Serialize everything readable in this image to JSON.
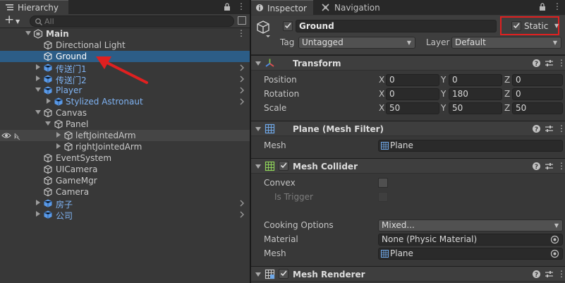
{
  "hierarchy": {
    "tab_label": "Hierarchy",
    "tab_icon": "hierarchy-list-icon",
    "add_button": "+",
    "search_placeholder": "All",
    "rows": [
      {
        "label": "Main",
        "type": "scene"
      },
      {
        "label": "Directional Light",
        "type": "gameobject"
      },
      {
        "label": "Ground",
        "type": "gameobject",
        "selected": true
      },
      {
        "label": "传送门1",
        "type": "prefab"
      },
      {
        "label": "传送门2",
        "type": "prefab"
      },
      {
        "label": "Player",
        "type": "prefab"
      },
      {
        "label": "Stylized Astronaut",
        "type": "prefab"
      },
      {
        "label": "Canvas",
        "type": "gameobject"
      },
      {
        "label": "Panel",
        "type": "gameobject"
      },
      {
        "label": "leftJointedArm",
        "type": "gameobject"
      },
      {
        "label": "rightJointedArm",
        "type": "gameobject"
      },
      {
        "label": "EventSystem",
        "type": "gameobject"
      },
      {
        "label": "UICamera",
        "type": "gameobject"
      },
      {
        "label": "GameMgr",
        "type": "gameobject"
      },
      {
        "label": "Camera",
        "type": "gameobject"
      },
      {
        "label": "房子",
        "type": "prefab"
      },
      {
        "label": "公司",
        "type": "prefab"
      }
    ]
  },
  "annotation": {
    "arrow_color": "#e02020",
    "highlight_color": "#e02020"
  },
  "inspector": {
    "tabs": [
      {
        "label": "Inspector",
        "icon": "info-icon",
        "active": true
      },
      {
        "label": "Navigation",
        "icon": "compass-icon",
        "active": false
      }
    ],
    "object": {
      "active": true,
      "name": "Ground",
      "static_checked": true,
      "static_label": "Static",
      "tag_label": "Tag",
      "tag_value": "Untagged",
      "layer_label": "Layer",
      "layer_value": "Default"
    },
    "transform": {
      "title": "Transform",
      "position_label": "Position",
      "rotation_label": "Rotation",
      "scale_label": "Scale",
      "axis_x": "X",
      "axis_y": "Y",
      "axis_z": "Z",
      "position": {
        "x": "0",
        "y": "0",
        "z": "0"
      },
      "rotation": {
        "x": "0",
        "y": "180",
        "z": "0"
      },
      "scale": {
        "x": "50",
        "y": "50",
        "z": "50"
      }
    },
    "mesh_filter": {
      "title": "Plane (Mesh Filter)",
      "mesh_label": "Mesh",
      "mesh_value": "Plane"
    },
    "mesh_collider": {
      "title": "Mesh Collider",
      "enabled": true,
      "convex_label": "Convex",
      "is_trigger_label": "Is Trigger",
      "cooking_options_label": "Cooking Options",
      "cooking_options_value": "Mixed...",
      "material_label": "Material",
      "material_value": "None (Physic Material)",
      "mesh_label": "Mesh",
      "mesh_value": "Plane"
    },
    "mesh_renderer": {
      "title": "Mesh Renderer",
      "enabled": true
    }
  },
  "colors": {
    "selection": "#2c5d87",
    "prefab_text": "#7fb3f3",
    "panel_bg": "#383838",
    "field_bg": "#2a2a2a"
  }
}
